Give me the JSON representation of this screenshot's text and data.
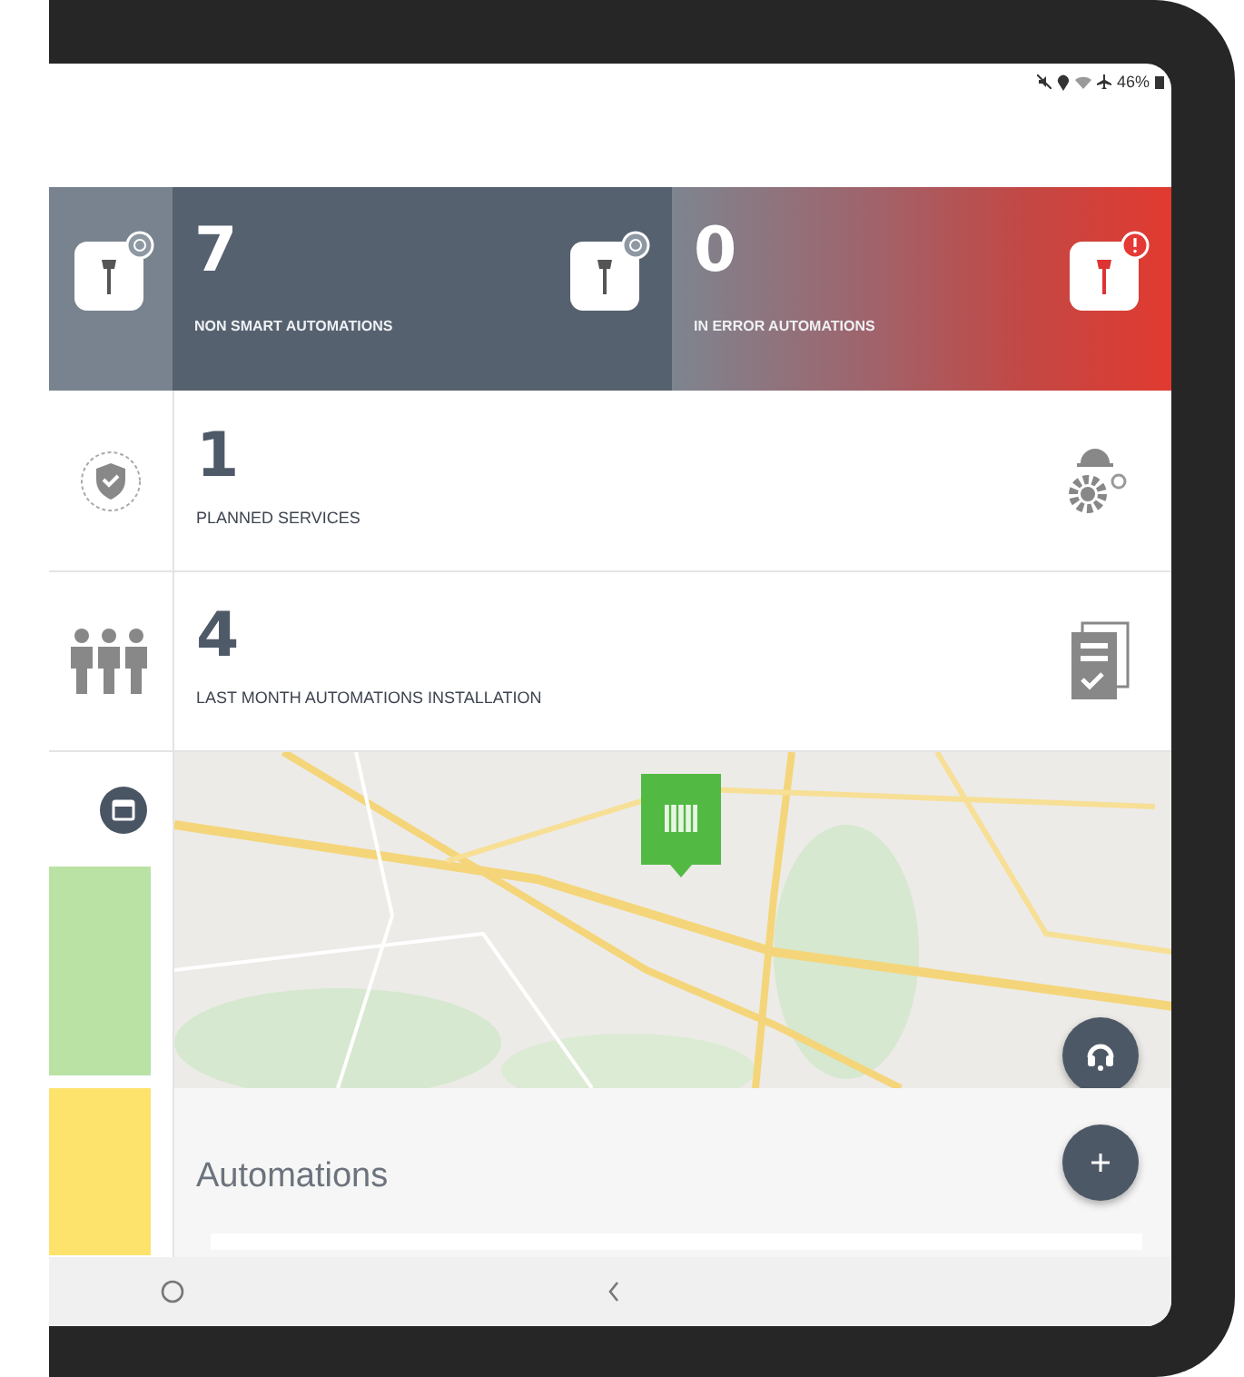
{
  "status_bar": {
    "battery": "46%"
  },
  "stat_tiles": [
    {
      "kind": "neutral",
      "value": "7",
      "label": "NON SMART AUTOMATIONS"
    },
    {
      "kind": "error",
      "value": "0",
      "label": "IN ERROR AUTOMATIONS"
    }
  ],
  "summary_rows": [
    {
      "kind": "services",
      "value": "1",
      "label": "PLANNED SERVICES"
    },
    {
      "kind": "installations",
      "value": "4",
      "label": "LAST MONTH AUTOMATIONS INSTALLATION"
    }
  ],
  "section": {
    "title": "Automations"
  }
}
